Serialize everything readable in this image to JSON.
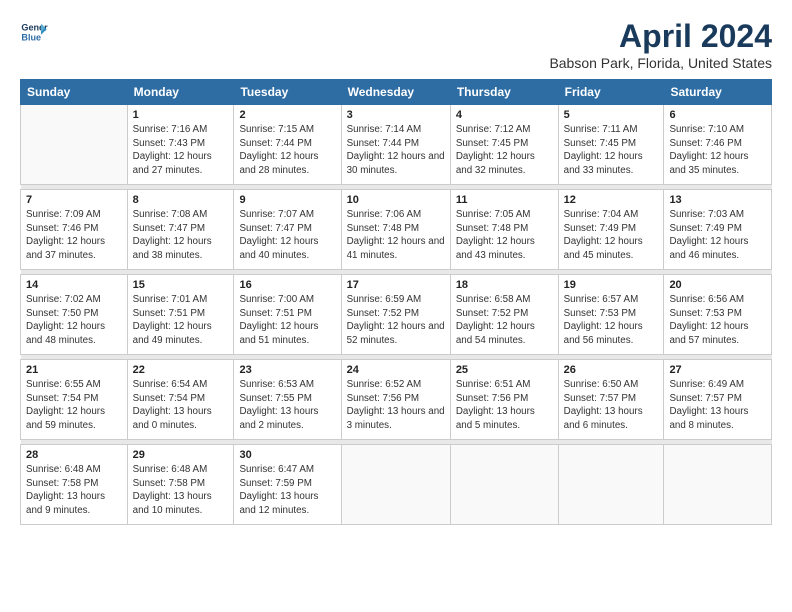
{
  "logo": {
    "line1": "General",
    "line2": "Blue"
  },
  "title": "April 2024",
  "subtitle": "Babson Park, Florida, United States",
  "weekdays": [
    "Sunday",
    "Monday",
    "Tuesday",
    "Wednesday",
    "Thursday",
    "Friday",
    "Saturday"
  ],
  "weeks": [
    [
      {
        "day": "",
        "info": ""
      },
      {
        "day": "1",
        "info": "Sunrise: 7:16 AM\nSunset: 7:43 PM\nDaylight: 12 hours\nand 27 minutes."
      },
      {
        "day": "2",
        "info": "Sunrise: 7:15 AM\nSunset: 7:44 PM\nDaylight: 12 hours\nand 28 minutes."
      },
      {
        "day": "3",
        "info": "Sunrise: 7:14 AM\nSunset: 7:44 PM\nDaylight: 12 hours\nand 30 minutes."
      },
      {
        "day": "4",
        "info": "Sunrise: 7:12 AM\nSunset: 7:45 PM\nDaylight: 12 hours\nand 32 minutes."
      },
      {
        "day": "5",
        "info": "Sunrise: 7:11 AM\nSunset: 7:45 PM\nDaylight: 12 hours\nand 33 minutes."
      },
      {
        "day": "6",
        "info": "Sunrise: 7:10 AM\nSunset: 7:46 PM\nDaylight: 12 hours\nand 35 minutes."
      }
    ],
    [
      {
        "day": "7",
        "info": "Sunrise: 7:09 AM\nSunset: 7:46 PM\nDaylight: 12 hours\nand 37 minutes."
      },
      {
        "day": "8",
        "info": "Sunrise: 7:08 AM\nSunset: 7:47 PM\nDaylight: 12 hours\nand 38 minutes."
      },
      {
        "day": "9",
        "info": "Sunrise: 7:07 AM\nSunset: 7:47 PM\nDaylight: 12 hours\nand 40 minutes."
      },
      {
        "day": "10",
        "info": "Sunrise: 7:06 AM\nSunset: 7:48 PM\nDaylight: 12 hours\nand 41 minutes."
      },
      {
        "day": "11",
        "info": "Sunrise: 7:05 AM\nSunset: 7:48 PM\nDaylight: 12 hours\nand 43 minutes."
      },
      {
        "day": "12",
        "info": "Sunrise: 7:04 AM\nSunset: 7:49 PM\nDaylight: 12 hours\nand 45 minutes."
      },
      {
        "day": "13",
        "info": "Sunrise: 7:03 AM\nSunset: 7:49 PM\nDaylight: 12 hours\nand 46 minutes."
      }
    ],
    [
      {
        "day": "14",
        "info": "Sunrise: 7:02 AM\nSunset: 7:50 PM\nDaylight: 12 hours\nand 48 minutes."
      },
      {
        "day": "15",
        "info": "Sunrise: 7:01 AM\nSunset: 7:51 PM\nDaylight: 12 hours\nand 49 minutes."
      },
      {
        "day": "16",
        "info": "Sunrise: 7:00 AM\nSunset: 7:51 PM\nDaylight: 12 hours\nand 51 minutes."
      },
      {
        "day": "17",
        "info": "Sunrise: 6:59 AM\nSunset: 7:52 PM\nDaylight: 12 hours\nand 52 minutes."
      },
      {
        "day": "18",
        "info": "Sunrise: 6:58 AM\nSunset: 7:52 PM\nDaylight: 12 hours\nand 54 minutes."
      },
      {
        "day": "19",
        "info": "Sunrise: 6:57 AM\nSunset: 7:53 PM\nDaylight: 12 hours\nand 56 minutes."
      },
      {
        "day": "20",
        "info": "Sunrise: 6:56 AM\nSunset: 7:53 PM\nDaylight: 12 hours\nand 57 minutes."
      }
    ],
    [
      {
        "day": "21",
        "info": "Sunrise: 6:55 AM\nSunset: 7:54 PM\nDaylight: 12 hours\nand 59 minutes."
      },
      {
        "day": "22",
        "info": "Sunrise: 6:54 AM\nSunset: 7:54 PM\nDaylight: 13 hours\nand 0 minutes."
      },
      {
        "day": "23",
        "info": "Sunrise: 6:53 AM\nSunset: 7:55 PM\nDaylight: 13 hours\nand 2 minutes."
      },
      {
        "day": "24",
        "info": "Sunrise: 6:52 AM\nSunset: 7:56 PM\nDaylight: 13 hours\nand 3 minutes."
      },
      {
        "day": "25",
        "info": "Sunrise: 6:51 AM\nSunset: 7:56 PM\nDaylight: 13 hours\nand 5 minutes."
      },
      {
        "day": "26",
        "info": "Sunrise: 6:50 AM\nSunset: 7:57 PM\nDaylight: 13 hours\nand 6 minutes."
      },
      {
        "day": "27",
        "info": "Sunrise: 6:49 AM\nSunset: 7:57 PM\nDaylight: 13 hours\nand 8 minutes."
      }
    ],
    [
      {
        "day": "28",
        "info": "Sunrise: 6:48 AM\nSunset: 7:58 PM\nDaylight: 13 hours\nand 9 minutes."
      },
      {
        "day": "29",
        "info": "Sunrise: 6:48 AM\nSunset: 7:58 PM\nDaylight: 13 hours\nand 10 minutes."
      },
      {
        "day": "30",
        "info": "Sunrise: 6:47 AM\nSunset: 7:59 PM\nDaylight: 13 hours\nand 12 minutes."
      },
      {
        "day": "",
        "info": ""
      },
      {
        "day": "",
        "info": ""
      },
      {
        "day": "",
        "info": ""
      },
      {
        "day": "",
        "info": ""
      }
    ]
  ]
}
